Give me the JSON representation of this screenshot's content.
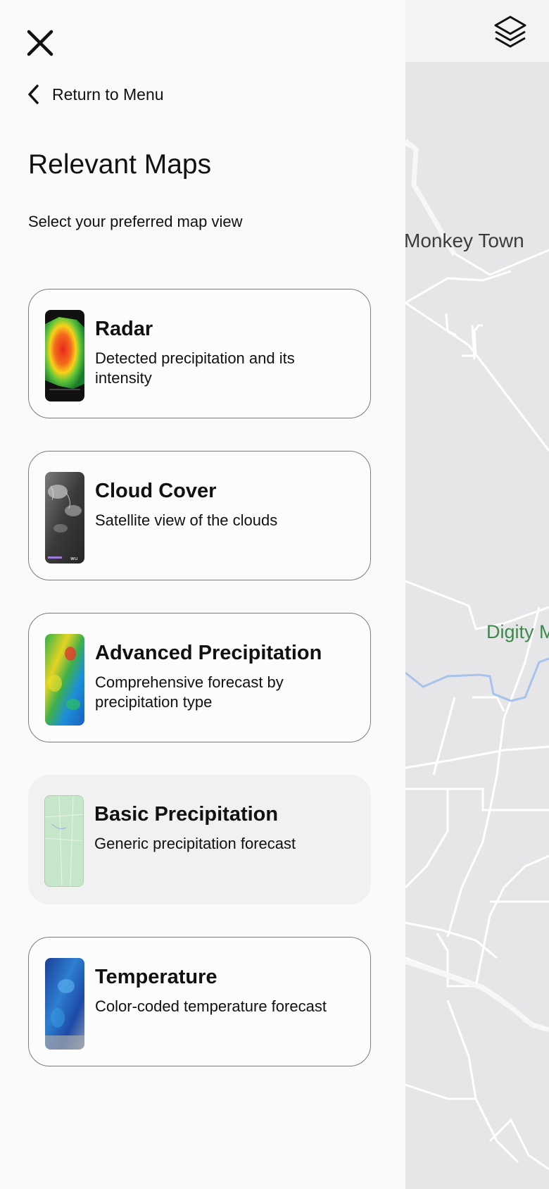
{
  "header": {
    "close_icon": "close-icon",
    "back_label": "Return to Menu",
    "back_icon": "chevron-left-icon"
  },
  "page": {
    "title": "Relevant Maps",
    "subtitle": "Select your preferred map view"
  },
  "maps": [
    {
      "name": "Radar",
      "description": "Detected precipitation and its intensity",
      "thumbnail": "radar-thumbnail",
      "selected": false
    },
    {
      "name": "Cloud Cover",
      "description": "Satellite view of the clouds",
      "thumbnail": "cloud-cover-thumbnail",
      "selected": false
    },
    {
      "name": "Advanced Precipitation",
      "description": "Comprehensive forecast by precipitation type",
      "thumbnail": "advanced-precipitation-thumbnail",
      "selected": false
    },
    {
      "name": "Basic Precipitation",
      "description": "Generic precipitation forecast",
      "thumbnail": "basic-precipitation-thumbnail",
      "selected": true
    },
    {
      "name": "Temperature",
      "description": "Color-coded temperature forecast",
      "thumbnail": "temperature-thumbnail",
      "selected": false
    }
  ],
  "map": {
    "labels": [
      "Monkey Town",
      "Digity M"
    ],
    "layers_icon": "layers-icon"
  },
  "colors": {
    "selected_card_bg": "#f1f1f1",
    "card_border": "#7d7d7d",
    "map_bg": "#e6e6e8",
    "place_label_green": "#3b8a4a"
  }
}
